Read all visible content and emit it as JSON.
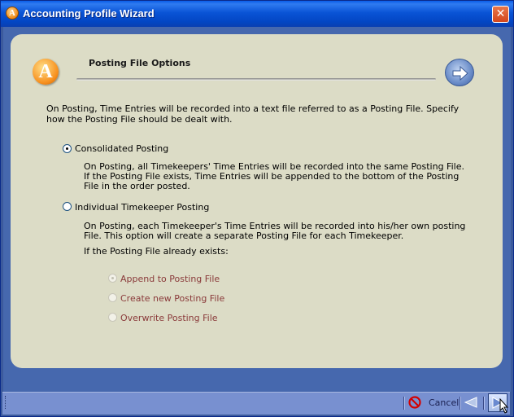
{
  "window": {
    "title": "Accounting Profile Wizard",
    "icon_letter": "A",
    "close_glyph": "✕"
  },
  "header": {
    "logo_letter": "A",
    "heading": "Posting File Options"
  },
  "intro_text": "On Posting, Time Entries will be recorded into a text file referred to as a Posting File. Specify how the Posting File should be dealt with.",
  "options": [
    {
      "label": "Consolidated Posting",
      "checked": true,
      "description": "On Posting, all Timekeepers' Time Entries will be recorded into the same Posting File. If the Posting File exists, Time Entries will be appended to the bottom of the Posting File in the order posted."
    },
    {
      "label": "Individual Timekeeper Posting",
      "checked": false,
      "description": "On Posting, each Timekeeper's Time Entries will be recorded into his/her own posting File. This option will create a separate Posting File for each Timekeeper.",
      "sub_prompt": "If the Posting File already exists:"
    }
  ],
  "sub_options": [
    {
      "label": "Append to Posting File",
      "checked": true,
      "enabled": false
    },
    {
      "label": "Create new Posting File",
      "checked": false,
      "enabled": false
    },
    {
      "label": "Overwrite Posting File",
      "checked": false,
      "enabled": false
    }
  ],
  "toolbar": {
    "cancel_label": "Cancel"
  },
  "colors": {
    "titlebar": "#0a54d6",
    "panel": "#dcdcc6",
    "window_body": "#4668ae",
    "disabled_text": "#8a3a3a",
    "logo_orange": "#f7901e"
  }
}
